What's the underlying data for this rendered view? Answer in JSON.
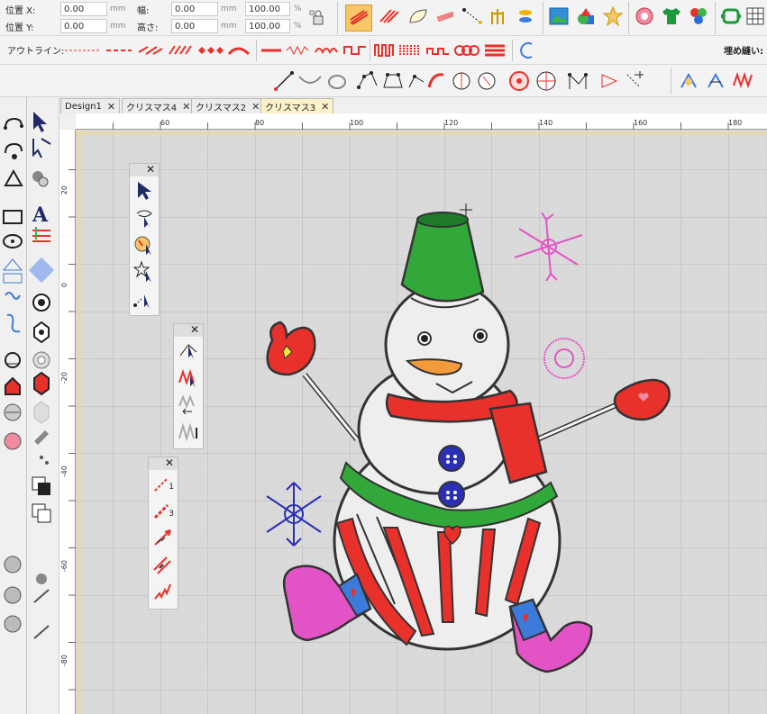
{
  "props": {
    "pos_x_label": "位置 X:",
    "pos_x_value": "0.00",
    "pos_x_unit": "mm",
    "pos_y_label": "位置 Y:",
    "pos_y_value": "0.00",
    "pos_y_unit": "mm",
    "width_label": "幅:",
    "width_value": "0.00",
    "width_unit": "mm",
    "height_label": "高さ:",
    "height_value": "0.00",
    "height_unit": "mm",
    "wpct_value": "100.00",
    "wpct_unit": "%",
    "hpct_value": "100.00",
    "hpct_unit": "%"
  },
  "outline_bar": {
    "label": "アウトライン:",
    "fill_label": "埋め縫い:"
  },
  "tabs": [
    {
      "label": "Design1",
      "close": "✕"
    },
    {
      "label": "クリスマス4",
      "close": "✕"
    },
    {
      "label": "クリスマス2",
      "close": "✕"
    },
    {
      "label": "クリスマス3",
      "close": "✕"
    }
  ],
  "ruler": {
    "h_labels": [
      "60",
      "80",
      "100",
      "120",
      "140",
      "160",
      "180"
    ],
    "v_labels": [
      "20",
      "0",
      "-20",
      "-40",
      "-60",
      "-80"
    ]
  },
  "panel1": {
    "close": "✕",
    "tools": [
      "select-arrow-icon",
      "lasso-select-icon",
      "paint-select-icon",
      "star-select-icon",
      "point-select-icon"
    ]
  },
  "panel2": {
    "close": "✕",
    "tools": [
      "edit-node-icon",
      "stitch-select-icon",
      "stitch-move-icon",
      "stitch-edit-icon"
    ]
  },
  "panel3": {
    "close": "✕",
    "tools": [
      "line-1-icon",
      "line-3-icon",
      "arrow-line-icon",
      "double-line-icon",
      "zigzag-line-icon"
    ],
    "labels": [
      "1",
      "3"
    ]
  },
  "colors": {
    "accent_tab": "#fdf1c8",
    "canvas": "#d8d8d8",
    "grid": "#bcbcbc",
    "stitch_red": "#e8312b",
    "stitch_green": "#33a83a",
    "stitch_pink": "#e254c6",
    "stitch_blue": "#2b2fb5"
  }
}
